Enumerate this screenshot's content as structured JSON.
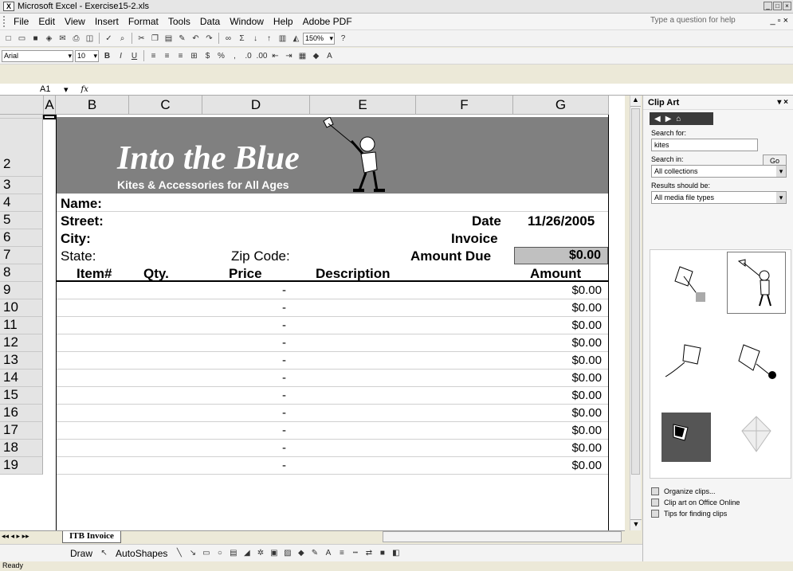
{
  "window": {
    "title": "Microsoft Excel - Exercise15-2.xls"
  },
  "menu": {
    "items": [
      "File",
      "Edit",
      "View",
      "Insert",
      "Format",
      "Tools",
      "Data",
      "Window",
      "Help",
      "Adobe PDF"
    ],
    "help_placeholder": "Type a question for help"
  },
  "toolbar": {
    "zoom": "150%",
    "font": "Arial",
    "size": "10"
  },
  "formula": {
    "cell": "A1",
    "fx": "fx"
  },
  "columns": [
    "A",
    "B",
    "C",
    "D",
    "E",
    "F",
    "G"
  ],
  "rows": [
    "1",
    "2",
    "3",
    "4",
    "5",
    "6",
    "7",
    "8",
    "9",
    "10",
    "11",
    "12",
    "13",
    "14",
    "15",
    "16",
    "17",
    "18",
    "19"
  ],
  "invoice": {
    "title": "Into the Blue",
    "subtitle": "Kites & Accessories for All Ages",
    "name": "Name:",
    "street": "Street:",
    "city": "City:",
    "state": "State:",
    "zip": "Zip Code:",
    "date_label": "Date",
    "date": "11/26/2005",
    "invoice": "Invoice",
    "amount_due_label": "Amount Due",
    "amount_due": "$0.00",
    "headers": [
      "Item#",
      "Qty.",
      "Price",
      "Description",
      "Amount"
    ],
    "lines": [
      {
        "price": "-",
        "amount": "$0.00"
      },
      {
        "price": "-",
        "amount": "$0.00"
      },
      {
        "price": "-",
        "amount": "$0.00"
      },
      {
        "price": "-",
        "amount": "$0.00"
      },
      {
        "price": "-",
        "amount": "$0.00"
      },
      {
        "price": "-",
        "amount": "$0.00"
      },
      {
        "price": "-",
        "amount": "$0.00"
      },
      {
        "price": "-",
        "amount": "$0.00"
      },
      {
        "price": "-",
        "amount": "$0.00"
      },
      {
        "price": "-",
        "amount": "$0.00"
      },
      {
        "price": "-",
        "amount": "$0.00"
      }
    ]
  },
  "sheet_tab": "ITB Invoice",
  "drawbar": {
    "draw": "Draw",
    "autoshapes": "AutoShapes"
  },
  "status": "Ready",
  "pane": {
    "title": "Clip Art",
    "search_label": "Search for:",
    "search_value": "kites",
    "go": "Go",
    "in_label": "Search in:",
    "in_value": "All collections",
    "results_label": "Results should be:",
    "results_value": "All media file types",
    "links": [
      "Organize clips...",
      "Clip art on Office Online",
      "Tips for finding clips"
    ]
  }
}
